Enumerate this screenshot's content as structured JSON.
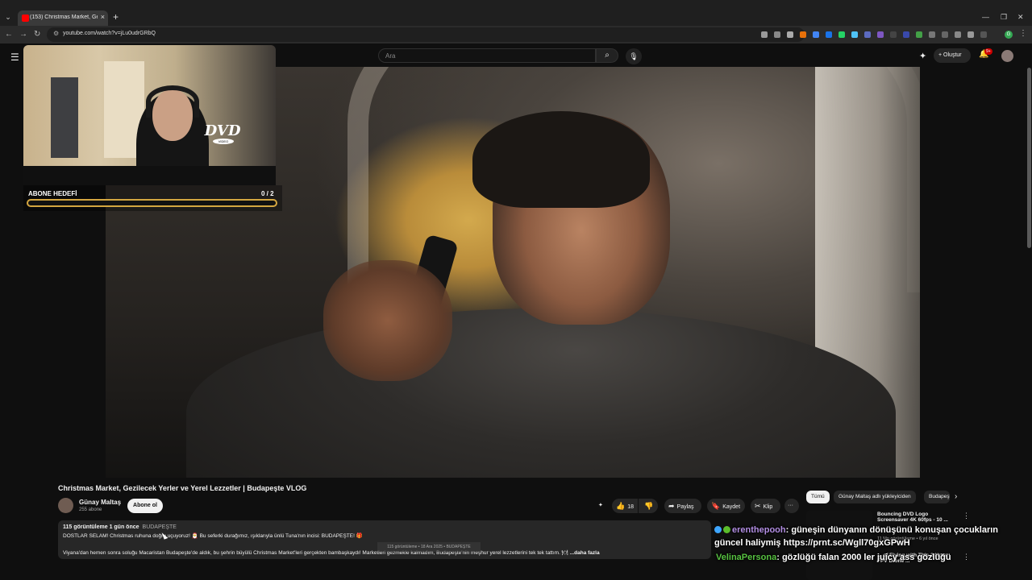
{
  "browser": {
    "tab_title": "(153) Christmas Market, Gezilec",
    "url": "youtube.com/watch?v=jLu0udrGRbQ",
    "new_tab": "+",
    "close": "×"
  },
  "youtube": {
    "search_placeholder": "Ara",
    "create_label": "Oluştur",
    "notification_count": "9+"
  },
  "overlay": {
    "goal_title": "ABONE HEDEFİ",
    "goal_count": "0 / 2",
    "goal_progress": 0.0,
    "dvd_text": "DVD",
    "dvd_sub": "VIDEO"
  },
  "video": {
    "title": "Christmas Market, Gezilecek Yerler ve Yerel Lezzetler | Budapeşte VLOG",
    "channel_name": "Günay Maltaş",
    "subscribers": "255 abone",
    "subscribe_label": "Abone ol",
    "likes": "18",
    "share_label": "Paylaş",
    "save_label": "Kaydet",
    "clip_label": "Klip",
    "more_label": "···"
  },
  "description": {
    "meta": "115 görüntüleme  1 gün önce",
    "tag": "BUDAPEŞTE",
    "line1": "DOSTLAR SELAM! Christmas ruhuna doğru uçuyoruz! 🎅 Bu seferki durağımız, ışıklarıyla ünlü Tuna'nın incisi: BUDAPEŞTE! 🎁",
    "line2": "Viyana'dan hemen sonra soluğu Macaristan Budapeşte'de aldık, bu şehrin büyülü Christmas Market'leri gerçekten bambaşkaydı! Marketleri gezmekle kalmadım, Budapeşte'nin meşhur yerel lezzetlerini tek tek tattım. 🍽",
    "more": "...daha fazla",
    "tooltip": "115 görüntüleme • 18 Ara 2025 • BUDAPEŞTE"
  },
  "chips": [
    "Tümü",
    "Günay Maltaş adlı yükleyiciden",
    "Budapeşte"
  ],
  "recommendations": [
    {
      "title": "Bouncing DVD Logo Screensaver 4K 60fps - 10 ...",
      "meta": "11 Mn görüntüleme • 6 yıl önce"
    },
    {
      "title": "... of Flying with This 2 Hour FPV Drone ...",
      "meta": ""
    }
  ],
  "chat": [
    {
      "user": "erenthepooh",
      "message": ": güneşin dünyanın dönüşünü konuşan çocukların",
      "message2": "güncel haliymiş https://prnt.sc/Wgll70gxGPwH"
    },
    {
      "user": "VelinaPersona",
      "message": ": gözlüğü falan 2000 ler juicy ass gözlüğü"
    }
  ],
  "colors": {
    "accent": "#d4a640",
    "youtube_red": "#ff0000",
    "background": "#0f0f0f"
  }
}
